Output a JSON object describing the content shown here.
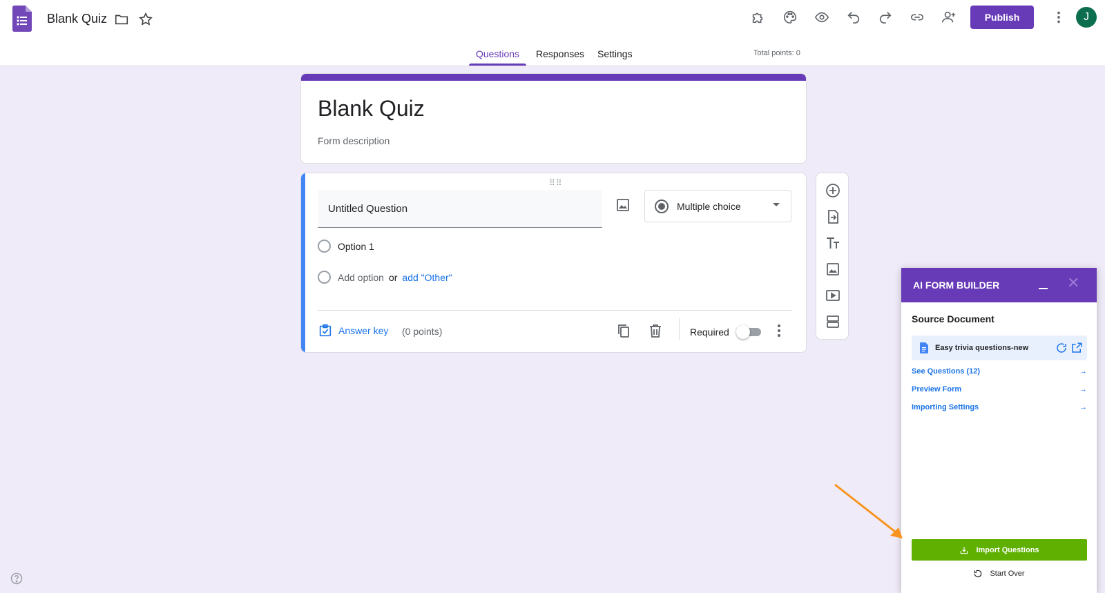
{
  "header": {
    "doc_title": "Blank Quiz",
    "publish_label": "Publish",
    "avatar_initial": "J",
    "total_points": "Total points: 0"
  },
  "tabs": [
    {
      "label": "Questions",
      "active": true
    },
    {
      "label": "Responses",
      "active": false
    },
    {
      "label": "Settings",
      "active": false
    }
  ],
  "form": {
    "title": "Blank Quiz",
    "description": "Form description"
  },
  "question": {
    "title": "Untitled Question",
    "type": "Multiple choice",
    "option1": "Option 1",
    "add_option": "Add option",
    "or": "or",
    "add_other": "add \"Other\"",
    "answer_key": "Answer key",
    "points": "(0 points)",
    "required_label": "Required",
    "required": false
  },
  "ai_panel": {
    "title": "AI FORM BUILDER",
    "source_title": "Source Document",
    "source_doc": "Easy trivia questions-new",
    "links": [
      {
        "label": "See Questions (12)",
        "arrow": "→"
      },
      {
        "label": "Preview Form",
        "arrow": "→"
      },
      {
        "label": "Importing Settings",
        "arrow": "→"
      }
    ],
    "import_label": "Import Questions",
    "start_over_label": "Start Over"
  },
  "colors": {
    "brand_purple": "#673ab7",
    "background": "#f0ebf8",
    "link_blue": "#1a73e8",
    "import_green": "#5fb000",
    "annotation_arrow": "#f7931e"
  },
  "icons": {
    "app": "forms-logo-icon",
    "header": [
      "folder-icon",
      "star-icon",
      "addons-icon",
      "palette-icon",
      "preview-eye-icon",
      "undo-icon",
      "redo-icon",
      "link-icon",
      "add-collaborator-icon",
      "more-vert-icon"
    ],
    "toolbar": [
      "add-question-icon",
      "import-questions-icon",
      "add-title-icon",
      "add-image-icon",
      "add-video-icon",
      "add-section-icon"
    ]
  }
}
